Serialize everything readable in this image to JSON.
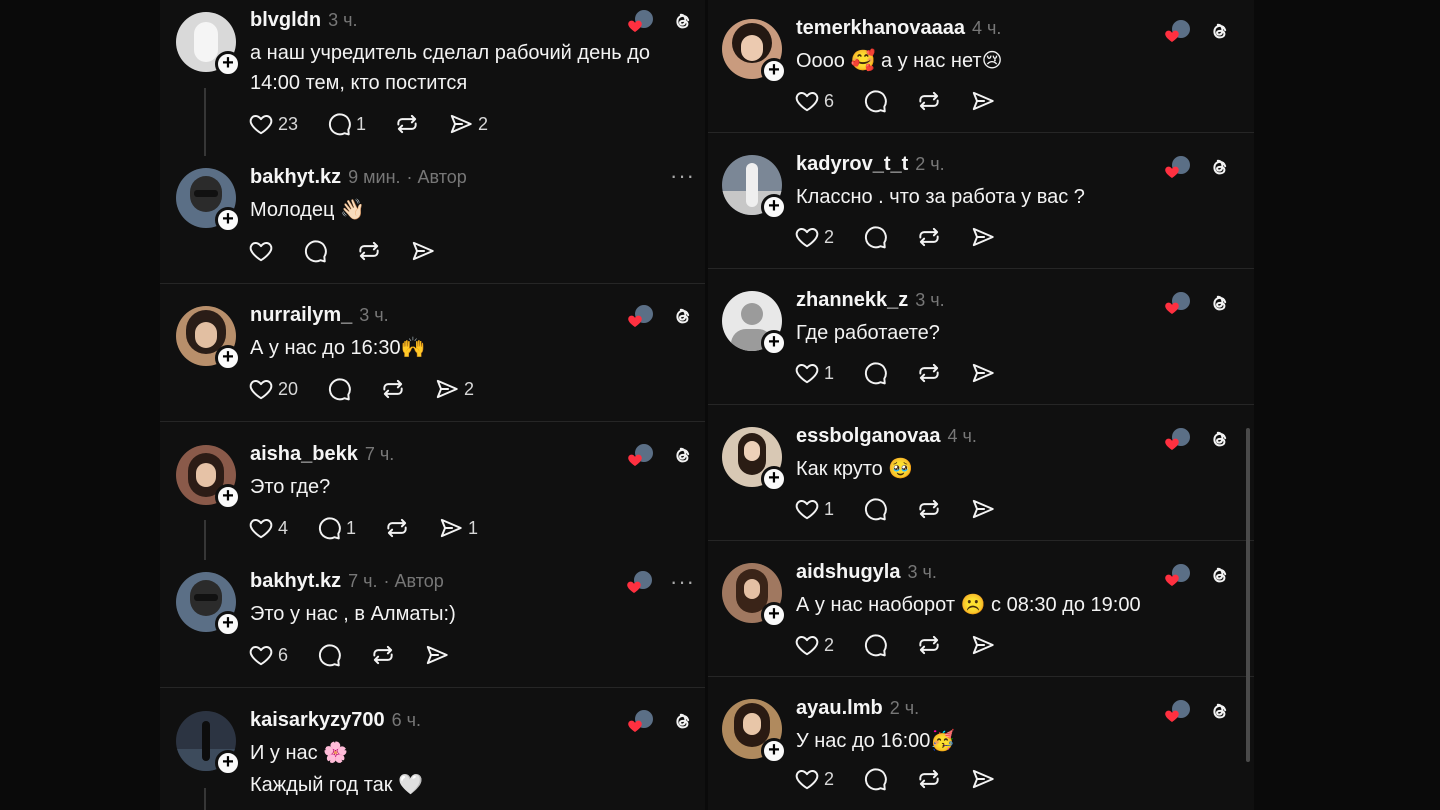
{
  "left_column": [
    {
      "username": "blvgldn",
      "time": "3 ч.",
      "author_tag": "",
      "lines": [
        "а наш учредитель сделал рабочий день до",
        "14:00 тем, кто постится"
      ],
      "likes": "23",
      "replies": "1",
      "reposts": "",
      "shares": "2",
      "avatar_bg": "#d9d9d9",
      "corner": "liked"
    },
    {
      "username": "bakhyt.kz",
      "time": "9 мин.",
      "author_tag": "· Автор",
      "lines": [
        "Молодец 👋🏻"
      ],
      "likes": "",
      "replies": "",
      "reposts": "",
      "shares": "",
      "avatar_bg": "#5b6f86",
      "corner": "more"
    },
    {
      "username": "nurrailym_",
      "time": "3 ч.",
      "author_tag": "",
      "lines": [
        "А у нас до 16:30🙌"
      ],
      "likes": "20",
      "replies": "",
      "reposts": "",
      "shares": "2",
      "avatar_bg": "#b88f6b",
      "corner": "liked"
    },
    {
      "username": "aisha_bekk",
      "time": "7 ч.",
      "author_tag": "",
      "lines": [
        "Это где?"
      ],
      "likes": "4",
      "replies": "1",
      "reposts": "",
      "shares": "1",
      "avatar_bg": "#8a5a4a",
      "corner": "liked"
    },
    {
      "username": "bakhyt.kz",
      "time": "7 ч.",
      "author_tag": "· Автор",
      "lines": [
        "Это у нас , в Алматы:)"
      ],
      "likes": "6",
      "replies": "",
      "reposts": "",
      "shares": "",
      "avatar_bg": "#5b6f86",
      "corner": "liked-more"
    },
    {
      "username": "kaisarkyzy700",
      "time": "6 ч.",
      "author_tag": "",
      "lines": [
        "И у нас 🌸",
        "Каждый год так 🤍"
      ],
      "likes": "",
      "replies": "",
      "reposts": "",
      "shares": "",
      "avatar_bg": "#2c3442",
      "corner": "liked"
    }
  ],
  "right_column": [
    {
      "username": "temerkhanovaaaa",
      "time": "4 ч.",
      "lines": [
        "Оооо 🥰 а у нас нет😢"
      ],
      "likes": "6",
      "avatar_bg": "#c99b7e"
    },
    {
      "username": "kadyrov_t_t",
      "time": "2 ч.",
      "lines": [
        "Классно . что за работа у вас ?"
      ],
      "likes": "2",
      "avatar_bg": "#7b8796"
    },
    {
      "username": "zhannekk_z",
      "time": "3 ч.",
      "lines": [
        "Где работаете?"
      ],
      "likes": "1",
      "avatar_bg": "#e8e8e8",
      "default_avatar": true
    },
    {
      "username": "essbolganovaa",
      "time": "4 ч.",
      "lines": [
        "Как круто 🥹"
      ],
      "likes": "1",
      "avatar_bg": "#d8c8b4"
    },
    {
      "username": "aidshugyla",
      "time": "3 ч.",
      "lines": [
        "А у нас наоборот ☹️ с 08:30 до 19:00"
      ],
      "likes": "2",
      "avatar_bg": "#a07860"
    },
    {
      "username": "ayau.lmb",
      "time": "2 ч.",
      "lines": [
        "У нас до 16:00🥳"
      ],
      "likes": "2",
      "avatar_bg": "#b08a5e"
    }
  ],
  "colors": {
    "heart": "#ff3040",
    "bg": "#101010",
    "muted": "#777777"
  },
  "icons": [
    "heart-icon",
    "comment-icon",
    "repost-icon",
    "share-icon",
    "threads-icon",
    "more-icon",
    "plus-icon"
  ]
}
